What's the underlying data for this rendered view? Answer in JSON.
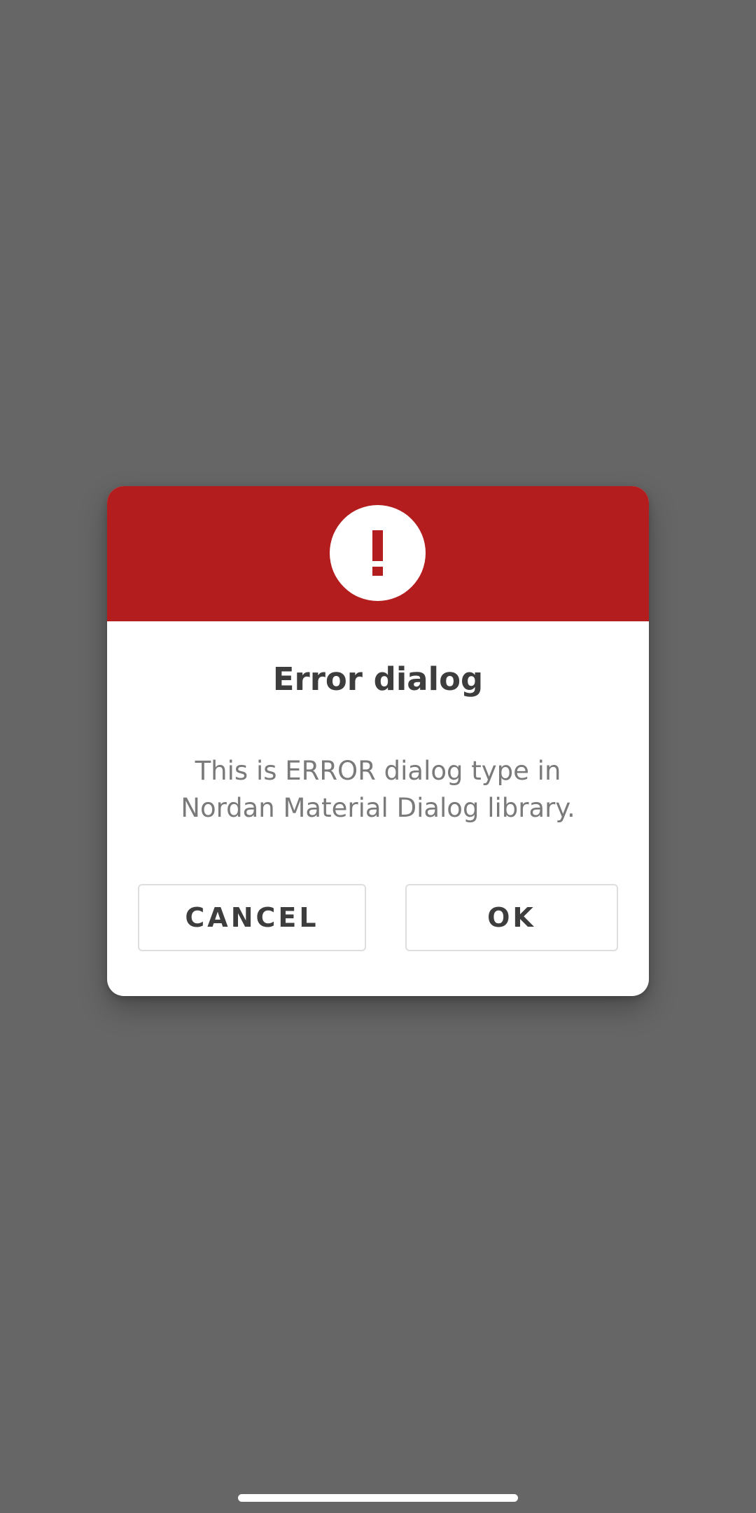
{
  "colors": {
    "backdrop": "#666666",
    "header_accent": "#b31d1d",
    "title_text": "#3d3d3d",
    "message_text": "#7a7a7a",
    "button_border": "#dedede"
  },
  "dialog": {
    "header_icon": "exclamation-icon",
    "title": "Error dialog",
    "message": "This is ERROR dialog type in Nordan Material Dialog library.",
    "buttons": {
      "cancel_label": "CANCEL",
      "ok_label": "OK"
    }
  },
  "system": {
    "home_indicator_icon": "home-indicator"
  }
}
